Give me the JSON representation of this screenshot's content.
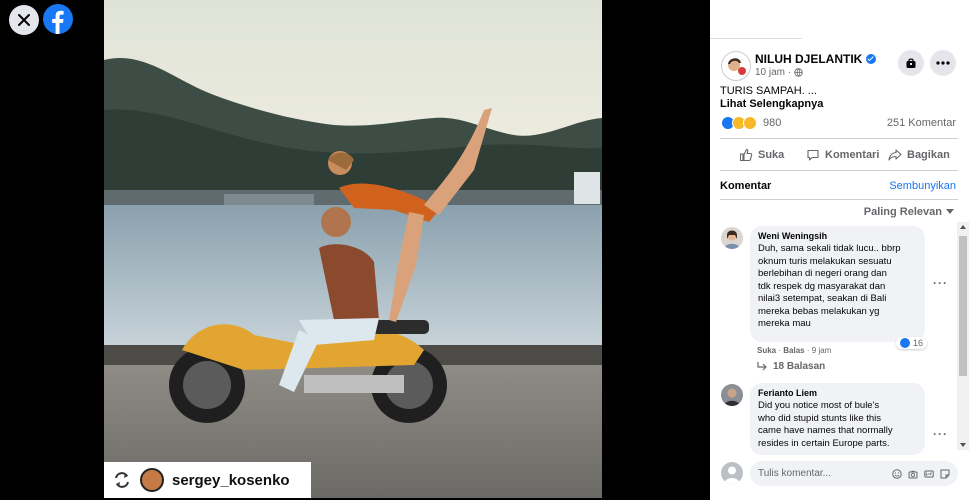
{
  "viewer": {
    "watermark_name": "sergey_kosenko"
  },
  "post": {
    "author": "NILUH DJELANTIK",
    "time": "10 jam ·",
    "text": "TURIS SAMPAH. ...",
    "see_more": "Lihat Selengkapnya",
    "reaction_count": "980",
    "comment_count": "251 Komentar"
  },
  "actions": {
    "like": "Suka",
    "comment": "Komentari",
    "share": "Bagikan"
  },
  "comments_header": {
    "label": "Komentar",
    "hide": "Sembunyikan",
    "sort": "Paling Relevan"
  },
  "comments": [
    {
      "name": "Weni Weningsih",
      "lines": [
        "Duh, sama sekali tidak lucu.. bbrp",
        "oknum turis melakukan sesuatu",
        "berlebihan di negeri orang dan",
        "tdk respek dg masyarakat dan",
        "nilai3 setempat, seakan di Bali",
        "mereka bebas melakukan yg",
        "mereka mau"
      ],
      "like": "Suka",
      "reply": "Balas",
      "time": "9 jam",
      "likes": "16",
      "replies": "18 Balasan"
    },
    {
      "name": "Ferianto Liem",
      "lines": [
        "Did you notice most of bule's",
        "who did stupid stunts like this",
        "came have names that normally",
        "resides in certain Europe parts."
      ]
    }
  ],
  "composer": {
    "placeholder": "Tulis komentar..."
  },
  "colors": {
    "accent": "#1877f2",
    "panel_bg": "#ffffff",
    "bubble_bg": "#f0f2f5"
  }
}
